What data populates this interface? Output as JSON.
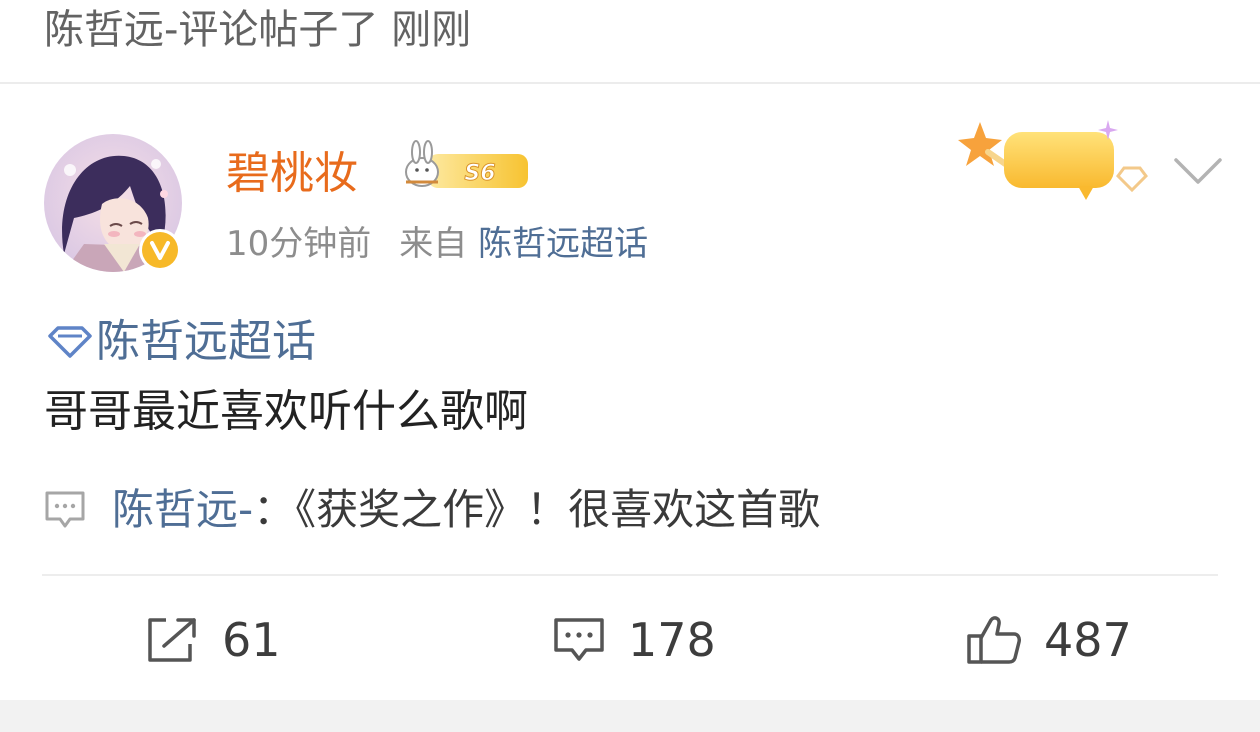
{
  "header": {
    "text": "陈哲远-评论帖子了 刚刚"
  },
  "post": {
    "author": {
      "name": "碧桃妆",
      "level_badge": "S6",
      "verified": true
    },
    "meta": {
      "time": "10分钟前",
      "source_prefix": "来自",
      "source_name": "陈哲远超话"
    },
    "supertopic_badge_label": "超话",
    "topic_tag": "陈哲远超话",
    "text": "哥哥最近喜欢听什么歌啊",
    "reply": {
      "author": "陈哲远-",
      "text": "：《获奖之作》！很喜欢这首歌"
    },
    "actions": {
      "repost_count": "61",
      "comment_count": "178",
      "like_count": "487"
    }
  },
  "colors": {
    "username": "#e86b1c",
    "link": "#4f6e95",
    "badge_gold": "#f7c331"
  }
}
